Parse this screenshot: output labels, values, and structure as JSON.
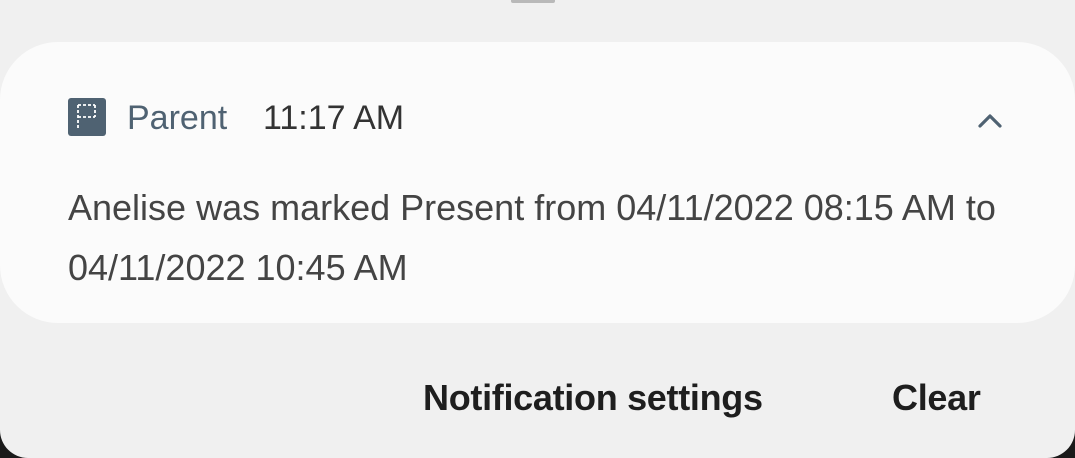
{
  "notification": {
    "app_name": "Parent",
    "app_icon": "flag-icon",
    "time": "11:17 AM",
    "message": "Anelise was marked Present from 04/11/2022 08:15 AM to 04/11/2022 10:45 AM",
    "collapse_icon": "chevron-up-icon"
  },
  "actions": {
    "settings_label": "Notification settings",
    "clear_label": "Clear"
  },
  "colors": {
    "panel_background": "#f0f0f0",
    "card_background": "#fbfbfb",
    "app_accent": "#4f6272",
    "message_text": "#444444",
    "action_text": "#1e1e1e"
  }
}
